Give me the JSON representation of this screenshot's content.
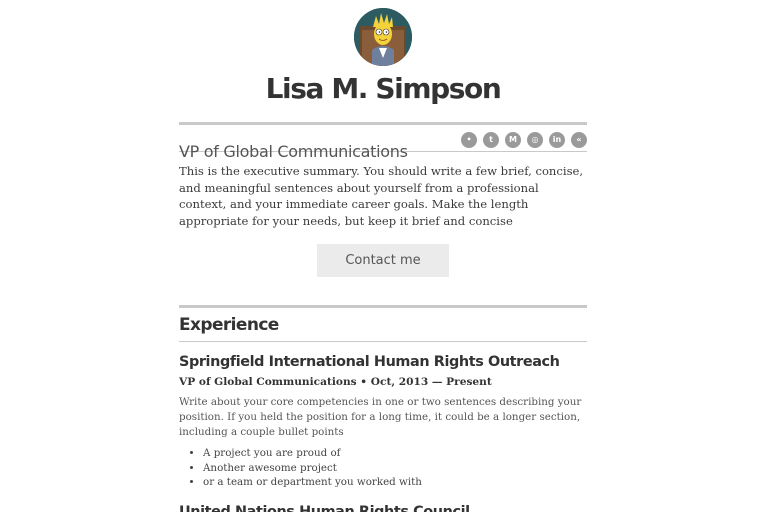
{
  "profile": {
    "name": "Lisa M. Simpson",
    "title": "VP of Global Communications",
    "summary": "This is the executive summary. You should write a few brief, concise, and meaningful sentences about yourself from a professional context, and your immediate career goals. Make the length appropriate for your needs, but keep it brief and concise",
    "contact_label": "Contact me"
  },
  "social": [
    {
      "icon": "github-icon",
      "glyph": "•"
    },
    {
      "icon": "twitter-icon",
      "glyph": "t"
    },
    {
      "icon": "medium-icon",
      "glyph": "M"
    },
    {
      "icon": "dribbble-icon",
      "glyph": "◎"
    },
    {
      "icon": "linkedin-icon",
      "glyph": "in"
    },
    {
      "icon": "website-icon",
      "glyph": "«"
    }
  ],
  "experience": {
    "heading": "Experience",
    "jobs": [
      {
        "company": "Springfield International Human Rights Outreach",
        "role": "VP of Global Communications • Oct, 2013 — Present",
        "description": "Write about your core competencies in one or two sentences describing your position. If you held the position for a long time, it could be a longer section, including a couple bullet points",
        "bullets": [
          "A project you are proud of",
          "Another awesome project",
          "or a team or department you worked with"
        ]
      },
      {
        "company": "United Nations Human Rights Council"
      }
    ]
  }
}
